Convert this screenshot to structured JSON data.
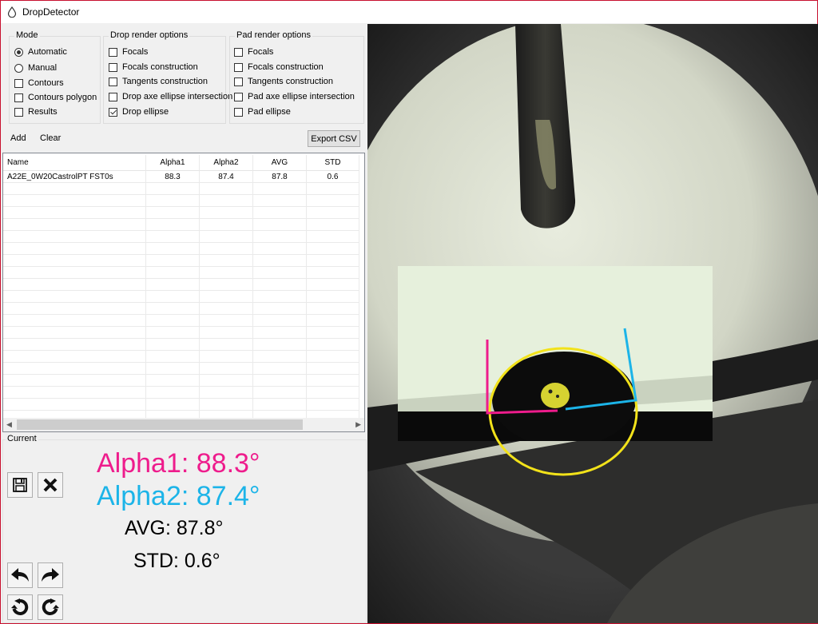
{
  "app": {
    "title": "DropDetector"
  },
  "mode": {
    "legend": "Mode",
    "automatic": "Automatic",
    "manual": "Manual",
    "contours": "Contours",
    "contours_polygon": "Contours polygon",
    "results": "Results",
    "selected": "automatic"
  },
  "drop_render": {
    "legend": "Drop render options",
    "focals": "Focals",
    "focals_construction": "Focals construction",
    "tangents_construction": "Tangents construction",
    "axe_intersection": "Drop axe ellipse intersection",
    "ellipse": "Drop ellipse",
    "ellipse_checked": true
  },
  "pad_render": {
    "legend": "Pad render options",
    "focals": "Focals",
    "focals_construction": "Focals construction",
    "tangents_construction": "Tangents construction",
    "axe_intersection": "Pad axe ellipse intersection",
    "ellipse": "Pad ellipse"
  },
  "toolbar": {
    "add": "Add",
    "clear": "Clear",
    "export": "Export CSV"
  },
  "table": {
    "columns": [
      "Name",
      "Alpha1",
      "Alpha2",
      "AVG",
      "STD"
    ],
    "rows": [
      [
        "A22E_0W20CastrolPT FST0s",
        "88.3",
        "87.4",
        "87.8",
        "0.6"
      ]
    ]
  },
  "current": {
    "legend": "Current",
    "alpha1": "Alpha1: 88.3°",
    "alpha2": "Alpha2: 87.4°",
    "avg": "AVG: 87.8°",
    "std": "STD: 0.6°"
  },
  "colors": {
    "alpha1": "#ee1c8c",
    "alpha2": "#1cb4e8",
    "ellipse": "#f2e21a"
  },
  "icons": [
    "droplet-icon",
    "save-icon",
    "close-icon",
    "undo-icon",
    "redo-icon",
    "rotate-left-icon",
    "rotate-right-icon"
  ]
}
